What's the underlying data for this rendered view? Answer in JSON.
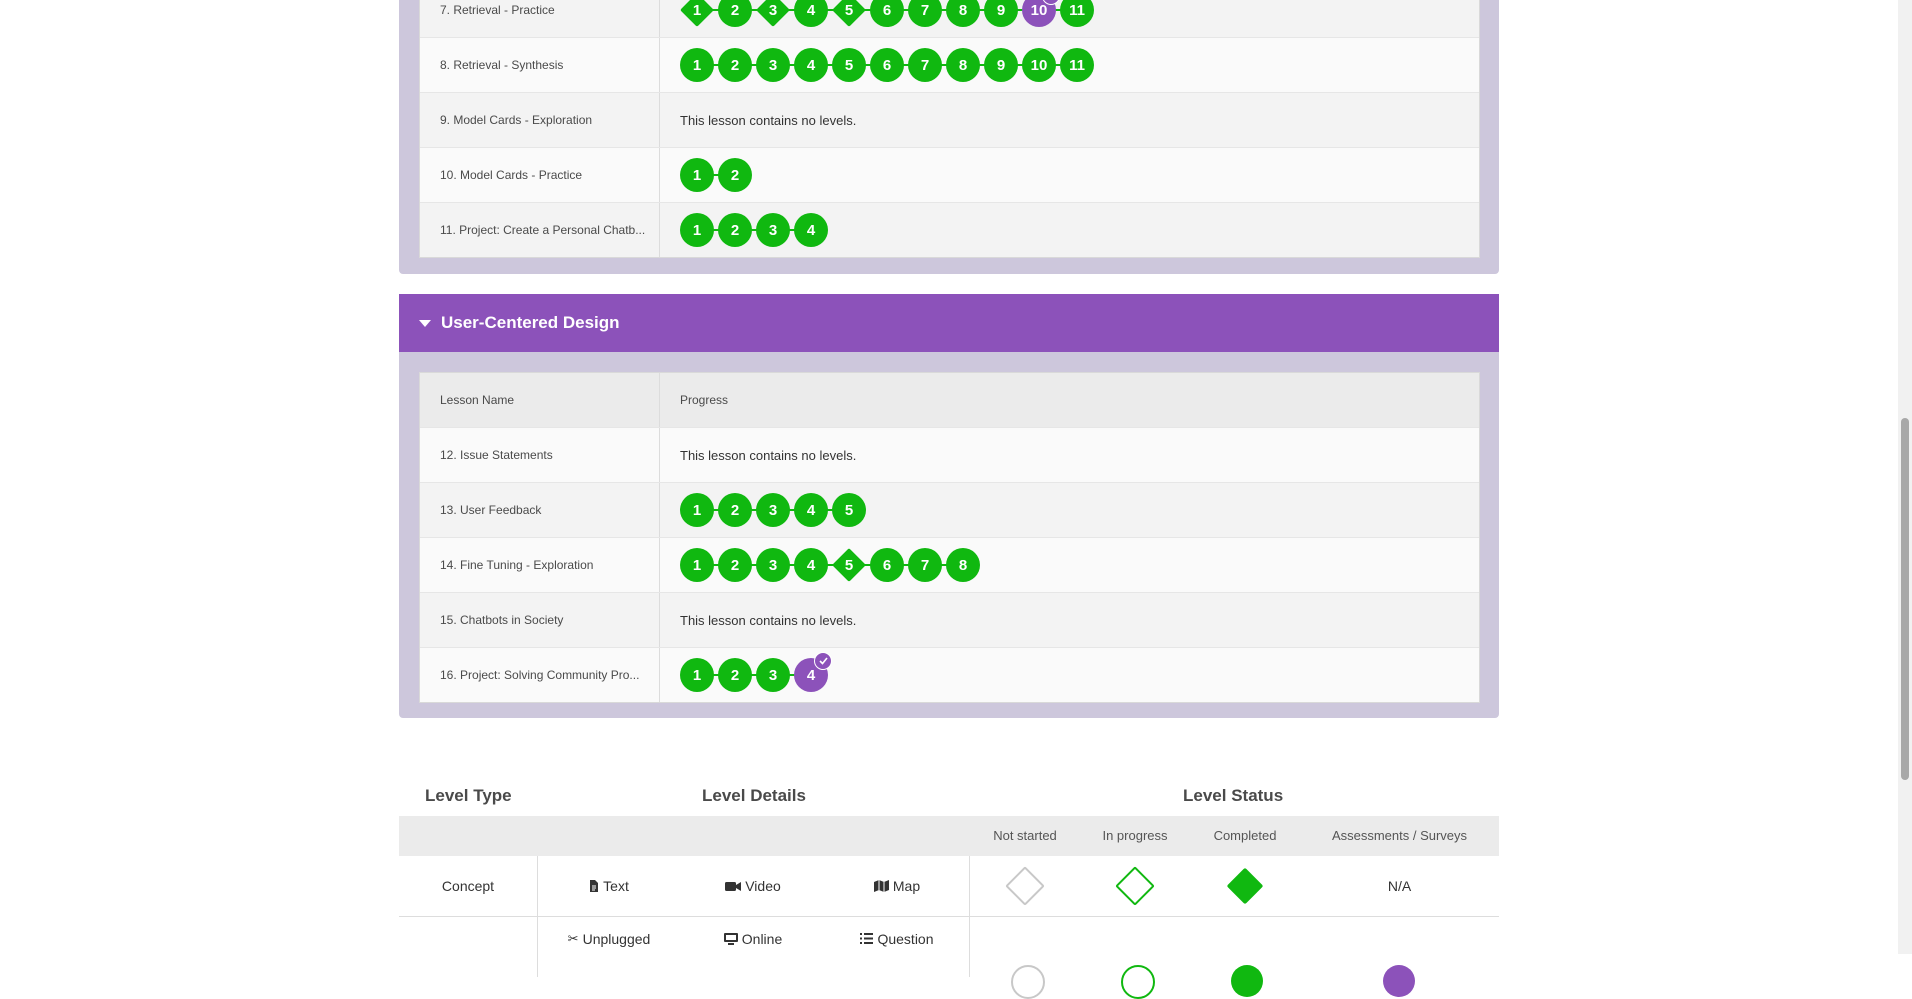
{
  "unit1": {
    "rows": [
      {
        "name": "7. Retrieval - Practice",
        "levels": [
          {
            "n": "1",
            "shape": "diamond",
            "color": "green"
          },
          {
            "n": "2",
            "shape": "circle",
            "color": "green"
          },
          {
            "n": "3",
            "shape": "diamond",
            "color": "green"
          },
          {
            "n": "4",
            "shape": "circle",
            "color": "green"
          },
          {
            "n": "5",
            "shape": "diamond",
            "color": "green"
          },
          {
            "n": "6",
            "shape": "circle",
            "color": "green"
          },
          {
            "n": "7",
            "shape": "circle",
            "color": "green"
          },
          {
            "n": "8",
            "shape": "circle",
            "color": "green"
          },
          {
            "n": "9",
            "shape": "circle",
            "color": "green"
          },
          {
            "n": "10",
            "shape": "circle",
            "color": "purple",
            "check": true
          },
          {
            "n": "11",
            "shape": "circle",
            "color": "green"
          }
        ]
      },
      {
        "name": "8. Retrieval - Synthesis",
        "levels": [
          {
            "n": "1",
            "shape": "circle",
            "color": "green"
          },
          {
            "n": "2",
            "shape": "circle",
            "color": "green"
          },
          {
            "n": "3",
            "shape": "circle",
            "color": "green"
          },
          {
            "n": "4",
            "shape": "circle",
            "color": "green"
          },
          {
            "n": "5",
            "shape": "circle",
            "color": "green"
          },
          {
            "n": "6",
            "shape": "circle",
            "color": "green"
          },
          {
            "n": "7",
            "shape": "circle",
            "color": "green"
          },
          {
            "n": "8",
            "shape": "circle",
            "color": "green"
          },
          {
            "n": "9",
            "shape": "circle",
            "color": "green"
          },
          {
            "n": "10",
            "shape": "circle",
            "color": "green"
          },
          {
            "n": "11",
            "shape": "circle",
            "color": "green"
          }
        ]
      },
      {
        "name": "9. Model Cards - Exploration",
        "empty": "This lesson contains no levels."
      },
      {
        "name": "10. Model Cards - Practice",
        "levels": [
          {
            "n": "1",
            "shape": "circle",
            "color": "green"
          },
          {
            "n": "2",
            "shape": "circle",
            "color": "green"
          }
        ]
      },
      {
        "name": "11. Project: Create a Personal Chatb...",
        "levels": [
          {
            "n": "1",
            "shape": "circle",
            "color": "green"
          },
          {
            "n": "2",
            "shape": "circle",
            "color": "green"
          },
          {
            "n": "3",
            "shape": "circle",
            "color": "green"
          },
          {
            "n": "4",
            "shape": "circle",
            "color": "green"
          }
        ]
      }
    ]
  },
  "unit2": {
    "title": "User-Centered Design",
    "header": {
      "lesson": "Lesson Name",
      "progress": "Progress"
    },
    "rows": [
      {
        "name": "12. Issue Statements",
        "empty": "This lesson contains no levels."
      },
      {
        "name": "13. User Feedback",
        "levels": [
          {
            "n": "1",
            "shape": "circle",
            "color": "green"
          },
          {
            "n": "2",
            "shape": "circle",
            "color": "green"
          },
          {
            "n": "3",
            "shape": "circle",
            "color": "green"
          },
          {
            "n": "4",
            "shape": "circle",
            "color": "green"
          },
          {
            "n": "5",
            "shape": "circle",
            "color": "green"
          }
        ]
      },
      {
        "name": "14. Fine Tuning - Exploration",
        "levels": [
          {
            "n": "1",
            "shape": "circle",
            "color": "green"
          },
          {
            "n": "2",
            "shape": "circle",
            "color": "green"
          },
          {
            "n": "3",
            "shape": "circle",
            "color": "green"
          },
          {
            "n": "4",
            "shape": "circle",
            "color": "green"
          },
          {
            "n": "5",
            "shape": "diamond",
            "color": "green"
          },
          {
            "n": "6",
            "shape": "circle",
            "color": "green"
          },
          {
            "n": "7",
            "shape": "circle",
            "color": "green"
          },
          {
            "n": "8",
            "shape": "circle",
            "color": "green"
          }
        ]
      },
      {
        "name": "15. Chatbots in Society",
        "empty": "This lesson contains no levels."
      },
      {
        "name": "16. Project: Solving Community Pro...",
        "levels": [
          {
            "n": "1",
            "shape": "circle",
            "color": "green"
          },
          {
            "n": "2",
            "shape": "circle",
            "color": "green"
          },
          {
            "n": "3",
            "shape": "circle",
            "color": "green"
          },
          {
            "n": "4",
            "shape": "circle",
            "color": "purple",
            "check": true
          }
        ]
      }
    ]
  },
  "key": {
    "level_type_title": "Level Type",
    "level_details_title": "Level Details",
    "level_status_title": "Level Status",
    "status_headers": [
      "Not started",
      "In progress",
      "Completed",
      "Assessments / Surveys"
    ],
    "concept_label": "Concept",
    "concept_items": [
      {
        "icon": "file-text-icon",
        "label": "Text"
      },
      {
        "icon": "video-icon",
        "label": "Video"
      },
      {
        "icon": "map-icon",
        "label": "Map"
      }
    ],
    "concept_na": "N/A",
    "activity_items": [
      {
        "icon": "scissors-icon",
        "label": "Unplugged"
      },
      {
        "icon": "desktop-icon",
        "label": "Online"
      },
      {
        "icon": "list-icon",
        "label": "Question"
      }
    ]
  },
  "colors": {
    "green": "#10b810",
    "purple": "#8c52ba"
  }
}
